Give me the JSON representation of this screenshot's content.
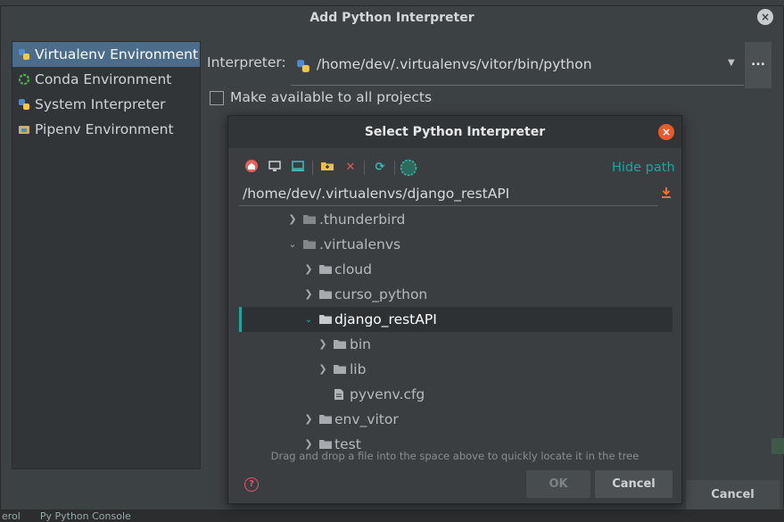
{
  "dialog": {
    "title": "Add Python Interpreter",
    "close_glyph": "×",
    "sidebar": {
      "items": [
        {
          "label": "Virtualenv Environment",
          "icon": "python-icon",
          "selected": true
        },
        {
          "label": "Conda Environment",
          "icon": "conda-icon",
          "selected": false
        },
        {
          "label": "System Interpreter",
          "icon": "python-icon",
          "selected": false
        },
        {
          "label": "Pipenv Environment",
          "icon": "pipenv-icon",
          "selected": false
        }
      ]
    },
    "interpreter_label": "Interpreter:",
    "interpreter_value": "/home/dev/.virtualenvs/vitor/bin/python",
    "browse_label": "...",
    "make_available_label": "Make available to all projects",
    "make_available_checked": false,
    "cancel_label": "Cancel"
  },
  "modal": {
    "title": "Select Python Interpreter",
    "close_glyph": "×",
    "toolbar": [
      "home-icon",
      "desktop-icon",
      "project-icon",
      "new-folder-icon",
      "delete-icon",
      "refresh-icon",
      "show-hidden-icon"
    ],
    "hide_path_label": "Hide path",
    "path_value": "/home/dev/.virtualenvs/django_restAPI",
    "tree": [
      {
        "label": ".thunderbird",
        "type": "folder",
        "expanded": false,
        "level": 0
      },
      {
        "label": ".virtualenvs",
        "type": "folder",
        "expanded": true,
        "level": 0
      },
      {
        "label": "cloud",
        "type": "folder",
        "expanded": false,
        "level": 1
      },
      {
        "label": "curso_python",
        "type": "folder",
        "expanded": false,
        "level": 1
      },
      {
        "label": "django_restAPI",
        "type": "folder",
        "expanded": true,
        "level": 1,
        "selected": true
      },
      {
        "label": "bin",
        "type": "folder",
        "expanded": false,
        "level": 2
      },
      {
        "label": "lib",
        "type": "folder",
        "expanded": false,
        "level": 2
      },
      {
        "label": "pyvenv.cfg",
        "type": "file",
        "level": 2
      },
      {
        "label": "env_vitor",
        "type": "folder",
        "expanded": false,
        "level": 1
      },
      {
        "label": "test",
        "type": "folder",
        "expanded": false,
        "level": 1
      }
    ],
    "hint": "Drag and drop a file into the space above to quickly locate it in the tree",
    "help_glyph": "?",
    "ok_label": "OK",
    "cancel_label": "Cancel"
  },
  "background": {
    "bottom_left": "erol",
    "bottom_tab": "Py Python Console"
  },
  "colors": {
    "accent": "#1fa5a0",
    "selection": "#4b6d8b",
    "close_red": "#e85b2c"
  }
}
